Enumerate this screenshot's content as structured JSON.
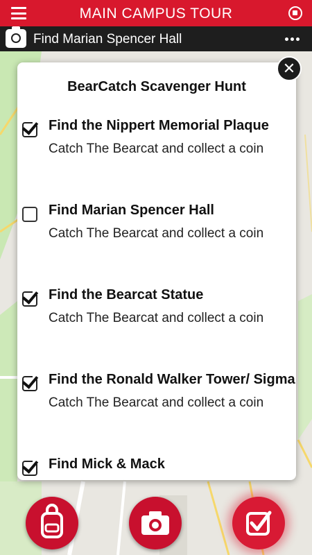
{
  "header": {
    "title": "MAIN CAMPUS TOUR",
    "menu_icon": "hamburger-menu-icon",
    "stop_icon": "stop-circle-icon"
  },
  "subheader": {
    "location_label": "Find Marian Spencer Hall",
    "camera_icon": "camera-icon",
    "more_icon": "more-dots-icon"
  },
  "modal": {
    "title": "BearCatch Scavenger Hunt",
    "tasks": [
      {
        "title": "Find the Nippert Memorial Plaque",
        "subtitle": "Catch The Bearcat and collect a coin",
        "checked": true
      },
      {
        "title": "Find Marian Spencer Hall",
        "subtitle": "Catch The Bearcat and collect a coin",
        "checked": false
      },
      {
        "title": "Find the Bearcat Statue",
        "subtitle": "Catch The Bearcat and collect a coin",
        "checked": true
      },
      {
        "title": "Find the Ronald Walker Tower/ Sigma",
        "subtitle": "Catch The Bearcat and collect a coin",
        "checked": true
      },
      {
        "title": "Find Mick & Mack",
        "subtitle": "",
        "checked": true
      }
    ],
    "close_icon": "close-icon"
  },
  "bottom_nav": [
    {
      "name": "backpack-button",
      "icon": "backpack-icon"
    },
    {
      "name": "camera-button",
      "icon": "camera-icon"
    },
    {
      "name": "checklist-button",
      "icon": "checkbox-icon",
      "active": true
    }
  ],
  "colors": {
    "brand_red": "#d8182d",
    "dark_bar": "#1e1e1e",
    "map_green": "#c8e6b0"
  }
}
